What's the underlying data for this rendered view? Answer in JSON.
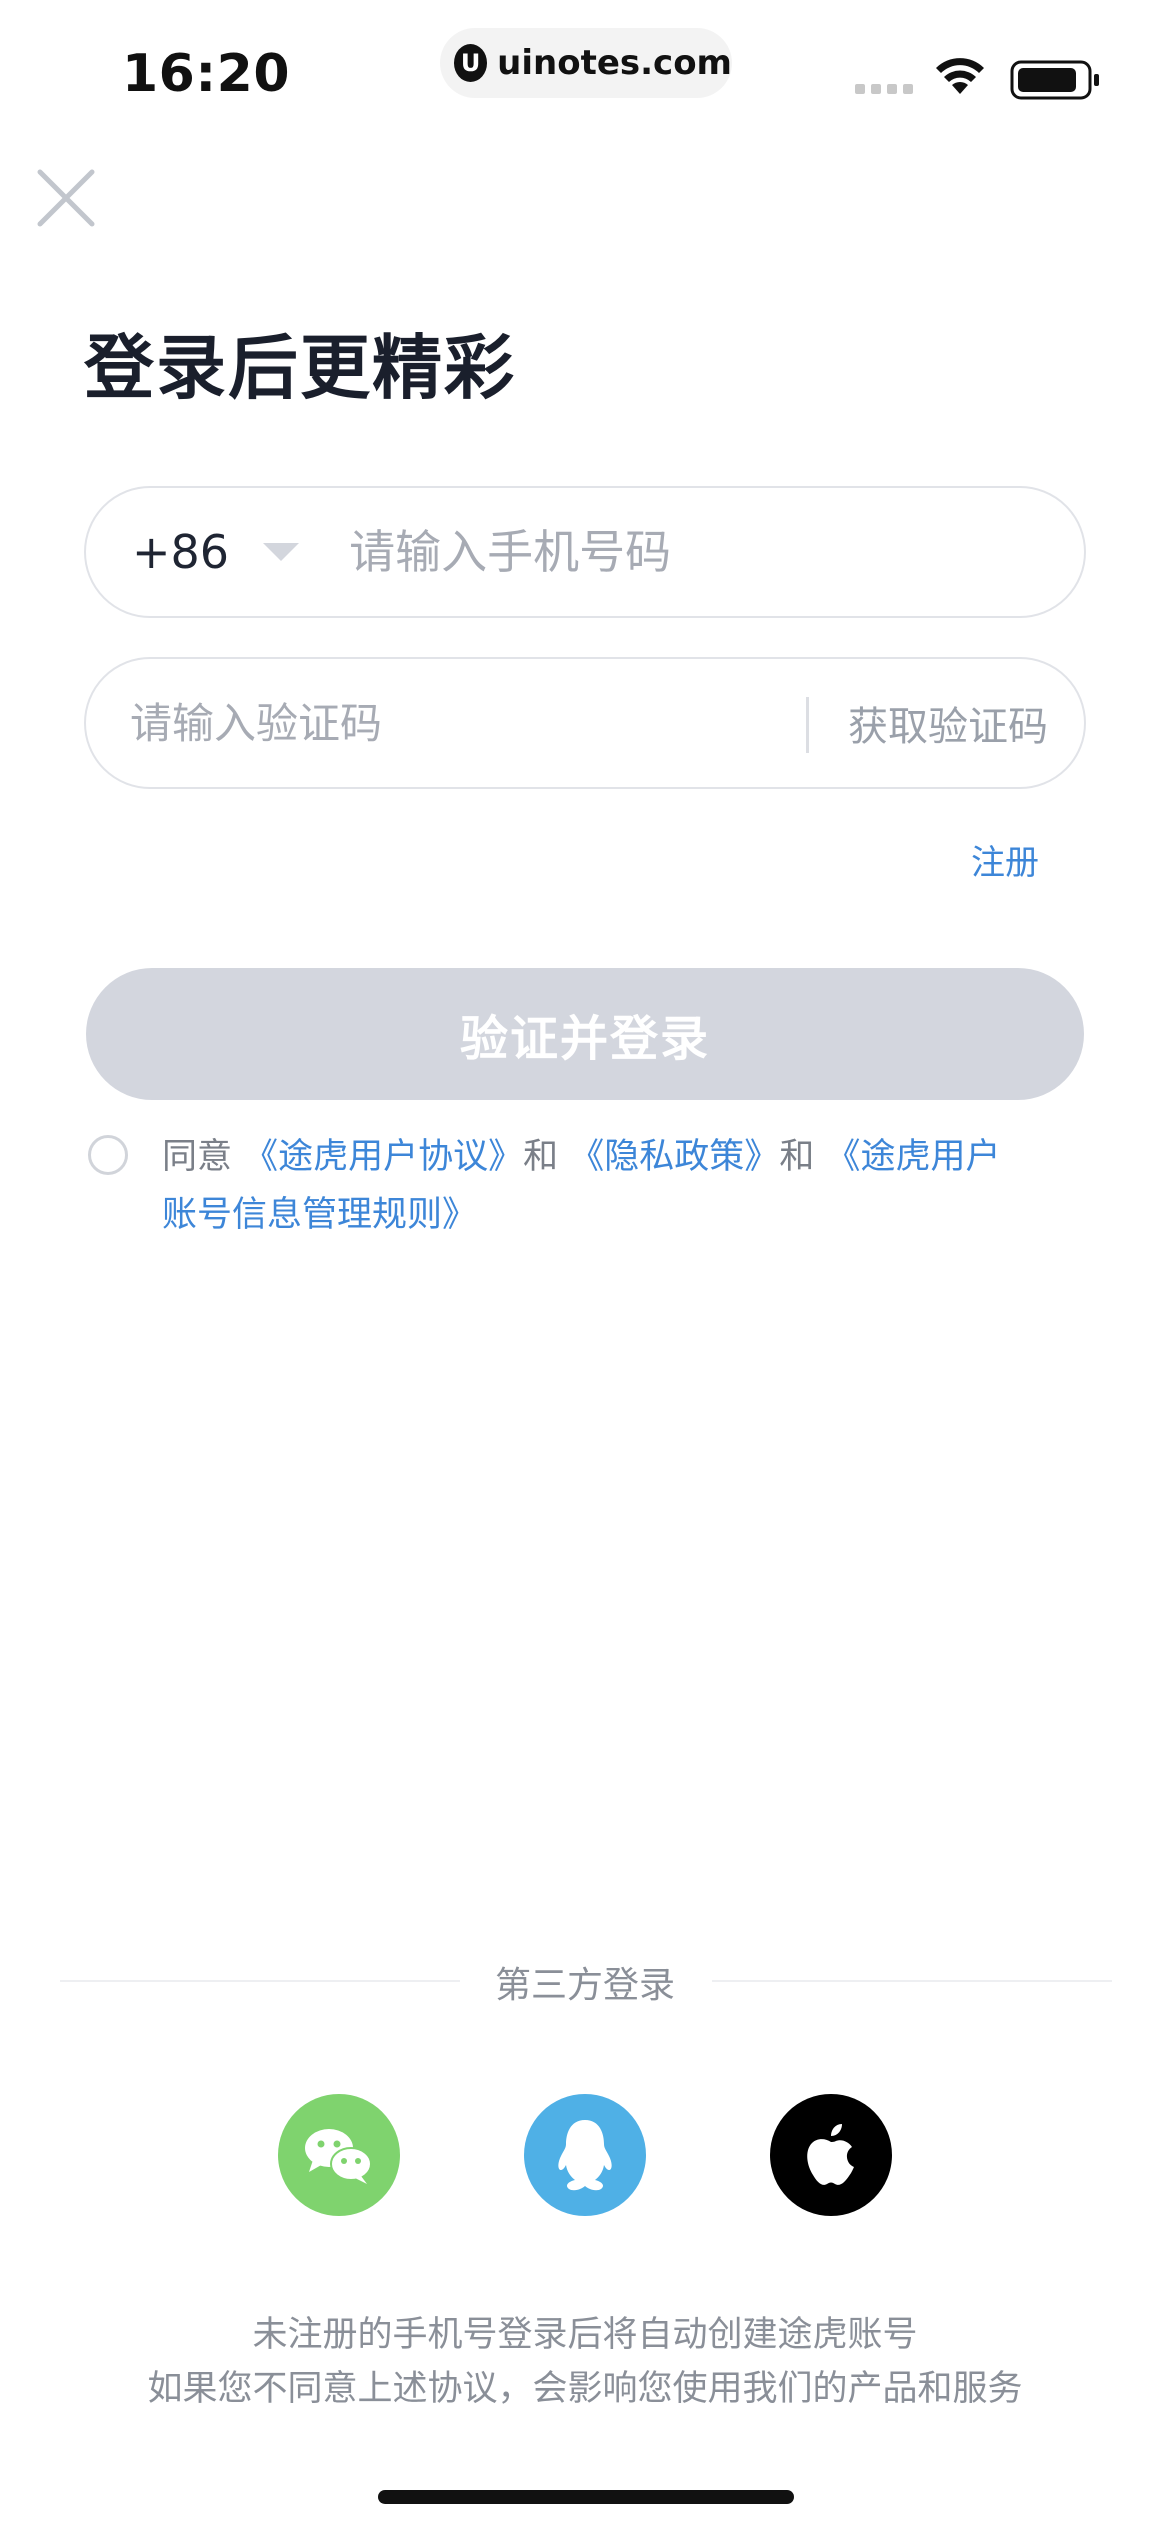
{
  "status_bar": {
    "time": "16:20",
    "url": "uinotes.com",
    "url_logo": "U"
  },
  "header": {
    "title": "登录后更精彩"
  },
  "phone_field": {
    "country_code": "+86",
    "placeholder": "请输入手机号码"
  },
  "code_field": {
    "placeholder": "请输入验证码",
    "get_code_label": "获取验证码"
  },
  "register_label": "注册",
  "login_button_label": "验证并登录",
  "agreement": {
    "prefix": "同意 ",
    "link1": "《途虎用户协议》",
    "and1": "和 ",
    "link2": "《隐私政策》",
    "and2": "和 ",
    "link3_line1": "《途虎用户",
    "link3_line2": "账号信息管理规则》"
  },
  "third_party": {
    "title": "第三方登录",
    "providers": [
      {
        "name": "wechat",
        "icon": "wechat-icon",
        "color": "#7fd36e"
      },
      {
        "name": "qq",
        "icon": "qq-icon",
        "color": "#4fb0e6"
      },
      {
        "name": "apple",
        "icon": "apple-icon",
        "color": "#000000"
      }
    ]
  },
  "footer": {
    "line1": "未注册的手机号登录后将自动创建途虎账号",
    "line2": "如果您不同意上述协议，会影响您使用我们的产品和服务"
  },
  "colors": {
    "link": "#3d86d8",
    "button_disabled": "#d3d6de",
    "border": "#e1e3e8"
  }
}
